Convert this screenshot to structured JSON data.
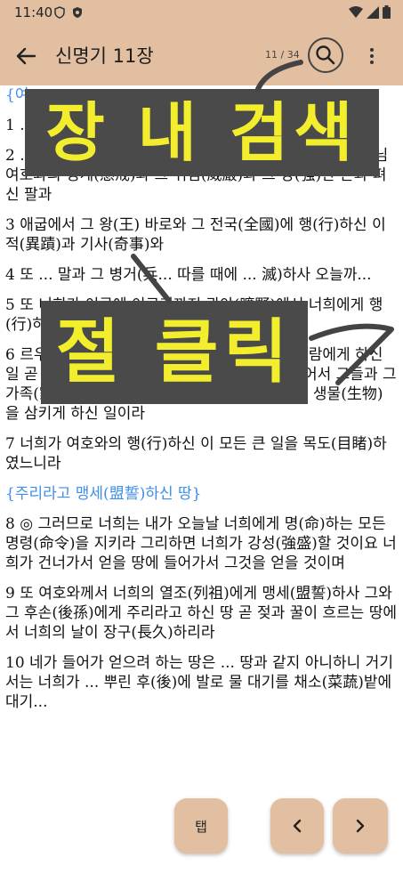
{
  "status": {
    "time": "11:40"
  },
  "app_bar": {
    "title": "신명기 11장",
    "page_count": "11 / 34"
  },
  "overlays": {
    "search_caption": "장 내 검색",
    "click_caption": "절 클릭"
  },
  "content": {
    "verses": [
      {
        "label": "{여",
        "heading": true
      },
      {
        "text": "1 ... 職任... 항..."
      },
      {
        "text": "2 ... 하였으나 너희가 오늘날 기억(記憶)할 것은 너희 하나님 여호와의 징계(懲戒)와 그 위엄(威嚴)과 그 강(強)한 손과 펴신 팔과"
      },
      {
        "text": "3 애굽에서 그 왕(王) 바로와 그 전국(全國)에 행(行)하신 이적(異蹟)과 기사(奇事)와"
      },
      {
        "text": "4 또 ... 말과 그 병거(兵... 따를 때에 ... 滅)하사 오늘까..."
      },
      {
        "text": "5 또 너희가 이곳에 이르기까지 광야(曠野)에서 너희에게 행(行)하신 일과"
      },
      {
        "text": "6 르우벤 자손(子孫) 엘리압의 아들 다단과 아비람에게 하신 일 곧 온 이스라엘의 한가운데서 땅으로 입을 열어서 그들과 그 가족(家族)과 그 장막(帳幕)과 그를 따르는 모든 생물(生物)을 삼키게 하신 일이라"
      },
      {
        "text": "7 너희가 여호와의 행(行)하신 이 모든 큰 일을 목도(目睹)하였느니라"
      },
      {
        "label": "{주리라고 맹세(盟誓)하신 땅}",
        "heading": true
      },
      {
        "text": "8 ◎ 그러므로 너희는 내가 오늘날 너희에게 명(命)하는 모든 명령(命令)을 지키라 그리하면 너희가 강성(強盛)할 것이요 너희가 건너가서 얻을 땅에 들어가서 그것을 얻을 것이며"
      },
      {
        "text": "9 또 여호와께서 너희의 열조(列祖)에게 맹세(盟誓)하사 그와 그 후손(後孫)에게 주리라고 하신 땅 곧 젖과 꿀이 흐르는 땅에서 너희의 날이 장구(長久)하리라"
      },
      {
        "text": "10 네가 들어가 얻으려 하는 땅은 ... 땅과 같지 아니하니 거기서는 너희가 ... 뿌린 후(後)에 발로 물 대기를 채소(菜蔬)밭에 대기..."
      }
    ]
  },
  "fab": {
    "tab_label": "탭",
    "prev_label": "‹",
    "next_label": "›"
  },
  "colors": {
    "app_bar": "#e2bfa0",
    "heading": "#3e8eea",
    "overlay_bg": "#4a4a4a",
    "overlay_text": "#f3ee2d"
  }
}
